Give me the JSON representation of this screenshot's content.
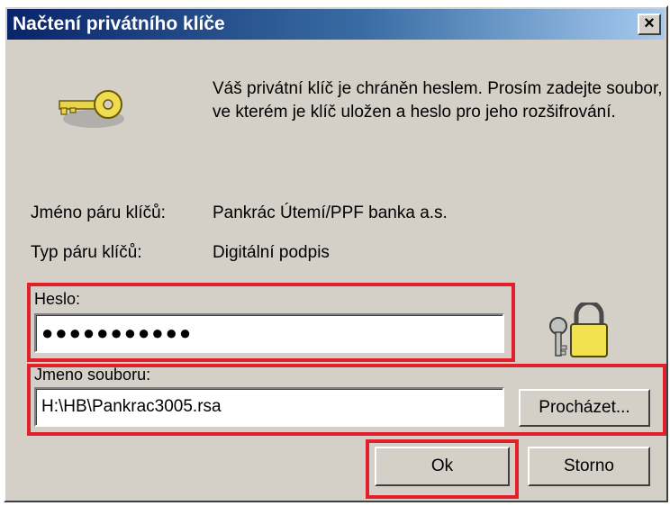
{
  "dialog": {
    "title": "Načtení privátního klíče",
    "close_glyph": "×",
    "message": "Váš privátní klíč je chráněn heslem. Prosím zadejte soubor, ve kterém je klíč uložen a heslo pro jeho rozšifrování.",
    "key_pair_name_label": "Jméno páru klíčů:",
    "key_pair_name_value": "Pankrác Útemí/PPF banka a.s.",
    "key_pair_type_label": "Typ páru klíčů:",
    "key_pair_type_value": "Digitální podpis",
    "password_label": "Heslo:",
    "password_value": "●●●●●●●●●●●",
    "file_label": "Jmeno souboru:",
    "file_value": "H:\\HB\\Pankrac3005.rsa",
    "browse_label": "Procházet...",
    "ok_label": "Ok",
    "cancel_label": "Storno"
  },
  "icons": {
    "key": "key-icon",
    "lock": "lock-keys-icon",
    "close": "close-icon"
  },
  "colors": {
    "title_gradient_start": "#0a246a",
    "title_gradient_end": "#a6caf0",
    "dialog_face": "#d4d0c8",
    "highlight_box": "#e0202a"
  }
}
